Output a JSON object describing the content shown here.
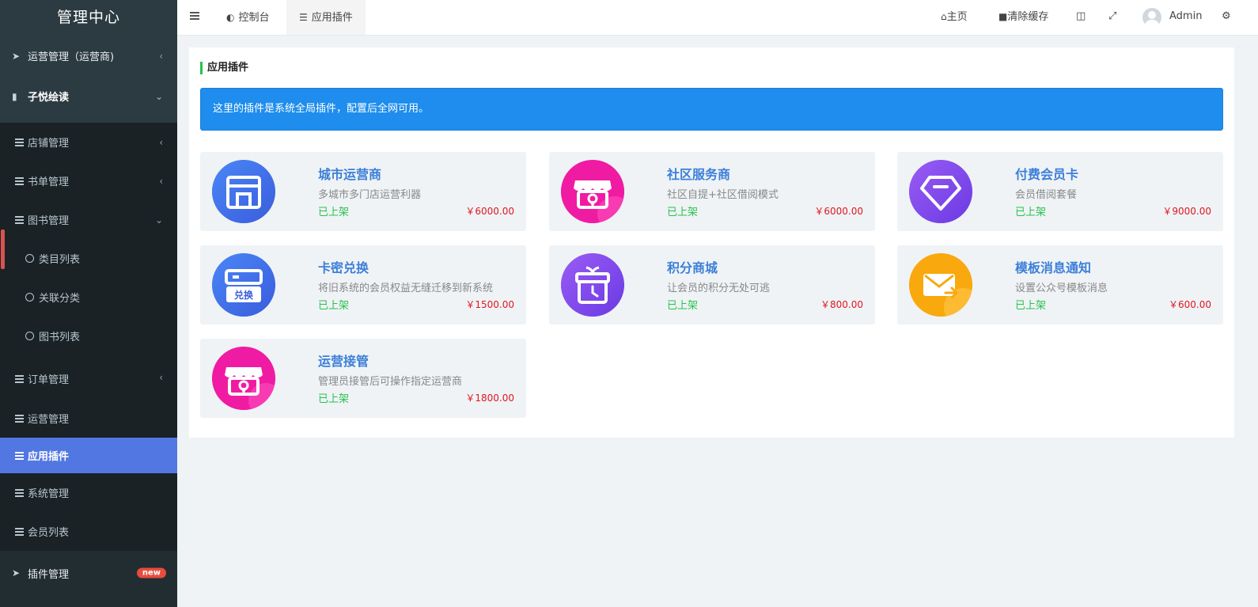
{
  "sidebar": {
    "logo": "管理中心",
    "items": [
      {
        "label": "运营管理（运营商)"
      },
      {
        "label": "子悦绘读"
      },
      {
        "label": "店铺管理"
      },
      {
        "label": "书单管理"
      },
      {
        "label": "图书管理"
      },
      {
        "label": "类目列表"
      },
      {
        "label": "关联分类"
      },
      {
        "label": "图书列表"
      },
      {
        "label": "订单管理"
      },
      {
        "label": "运营管理"
      },
      {
        "label": "应用插件"
      },
      {
        "label": "系统管理"
      },
      {
        "label": "会员列表"
      },
      {
        "label": "插件管理"
      }
    ],
    "badge": "new"
  },
  "header": {
    "tabs": [
      {
        "label": "控制台"
      },
      {
        "label": "应用插件"
      }
    ],
    "home": "主页",
    "clear_cache": "清除缓存",
    "user": "Admin"
  },
  "panel": {
    "title": "应用插件",
    "notice": "这里的插件是系统全局插件，配置后全网可用。"
  },
  "plugins": [
    {
      "name": "城市运营商",
      "desc": "多城市多门店运营利器",
      "status": "已上架",
      "price": "￥6000.00",
      "icon": "store-icon",
      "color": "#3b6ef0"
    },
    {
      "name": "社区服务商",
      "desc": "社区自提+社区借阅模式",
      "status": "已上架",
      "price": "￥6000.00",
      "icon": "shop-location-icon",
      "color": "#f01ba3"
    },
    {
      "name": "付费会员卡",
      "desc": "会员借阅套餐",
      "status": "已上架",
      "price": "￥9000.00",
      "icon": "diamond-icon",
      "color": "#7b4cef"
    },
    {
      "name": "卡密兑换",
      "desc": "将旧系统的会员权益无缝迁移到新系统",
      "status": "已上架",
      "price": "￥1500.00",
      "icon": "exchange-card-icon",
      "color": "#3b6ef0",
      "icon_text": "兑换"
    },
    {
      "name": "积分商城",
      "desc": "让会员的积分无处可逃",
      "status": "已上架",
      "price": "￥800.00",
      "icon": "gift-clock-icon",
      "color": "#7b4cef"
    },
    {
      "name": "模板消息通知",
      "desc": "设置公众号模板消息",
      "status": "已上架",
      "price": "￥600.00",
      "icon": "mail-forward-icon",
      "color": "#f9a80e"
    },
    {
      "name": "运营接管",
      "desc": "管理员接管后可操作指定运营商",
      "status": "已上架",
      "price": "￥1800.00",
      "icon": "shop-location-icon",
      "color": "#f01ba3"
    }
  ]
}
